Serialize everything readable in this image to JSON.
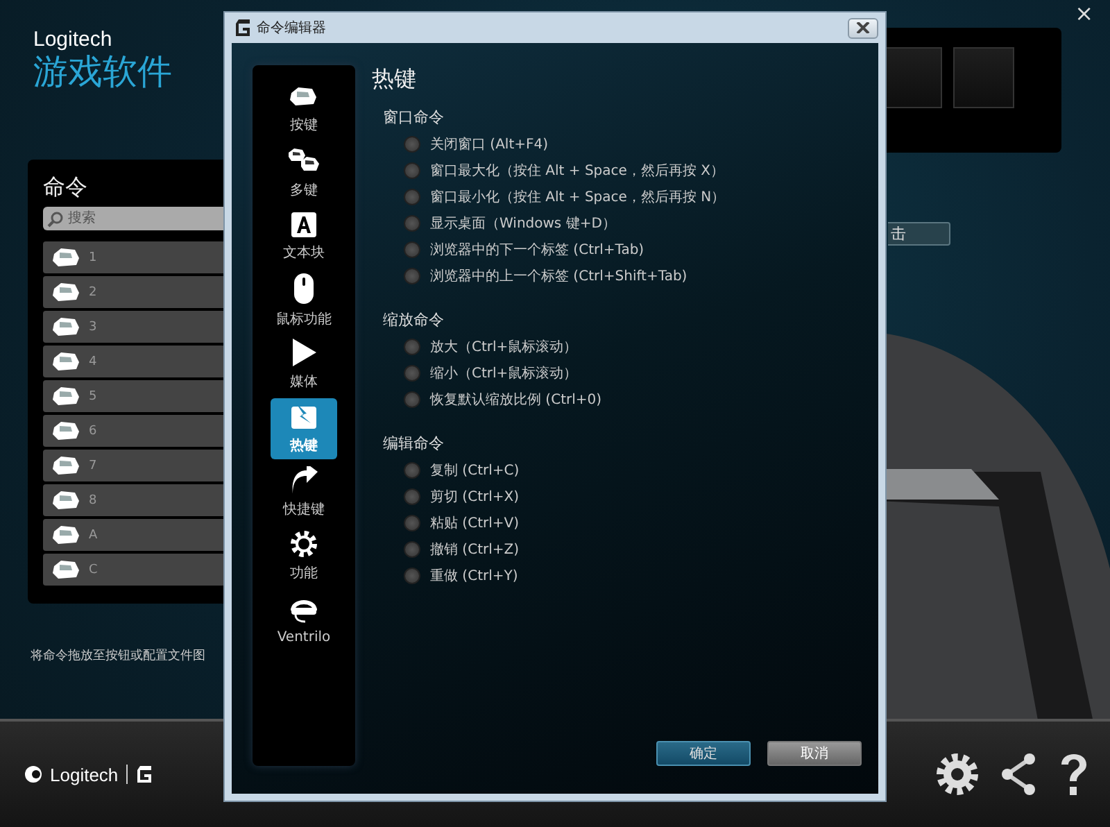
{
  "app": {
    "brand": "Logitech",
    "title": "游戏软件",
    "close": "×",
    "commands": {
      "title": "命令",
      "search": {
        "placeholder": "搜索"
      },
      "items": [
        {
          "label": "1"
        },
        {
          "label": "2"
        },
        {
          "label": "3"
        },
        {
          "label": "4"
        },
        {
          "label": "5"
        },
        {
          "label": "6"
        },
        {
          "label": "7"
        },
        {
          "label": "8"
        },
        {
          "label": "A"
        },
        {
          "label": "C"
        }
      ]
    },
    "hint": "将命令拖放至按钮或配置文件图",
    "partial_button": "击",
    "footer": {
      "logo": "Logitech"
    }
  },
  "dialog": {
    "title": "命令编辑器",
    "sidebar": [
      {
        "kind": "key",
        "label": "按键",
        "selected": false
      },
      {
        "kind": "multikey",
        "label": "多键",
        "selected": false
      },
      {
        "kind": "text",
        "label": "文本块",
        "selected": false
      },
      {
        "kind": "mouse",
        "label": "鼠标功能",
        "selected": false
      },
      {
        "kind": "media",
        "label": "媒体",
        "selected": false
      },
      {
        "kind": "hotkey",
        "label": "热键",
        "selected": true
      },
      {
        "kind": "shortcut",
        "label": "快捷键",
        "selected": false
      },
      {
        "kind": "function",
        "label": "功能",
        "selected": false
      },
      {
        "kind": "headset",
        "label": "Ventrilo",
        "selected": false
      }
    ],
    "heading": "热键",
    "groups": [
      {
        "title": "窗口命令",
        "options": [
          {
            "label": "关闭窗口 (Alt+F4)",
            "selected": false
          },
          {
            "label": "窗口最大化（按住 Alt + Space，然后再按 X）",
            "selected": false
          },
          {
            "label": "窗口最小化（按住 Alt + Space，然后再按 N）",
            "selected": false
          },
          {
            "label": "显示桌面（Windows 键+D）",
            "selected": false
          },
          {
            "label": "浏览器中的下一个标签 (Ctrl+Tab)",
            "selected": false
          },
          {
            "label": "浏览器中的上一个标签 (Ctrl+Shift+Tab)",
            "selected": false
          }
        ]
      },
      {
        "title": "缩放命令",
        "options": [
          {
            "label": "放大（Ctrl+鼠标滚动）",
            "selected": false
          },
          {
            "label": "缩小（Ctrl+鼠标滚动）",
            "selected": false
          },
          {
            "label": "恢复默认缩放比例 (Ctrl+0)",
            "selected": false
          }
        ]
      },
      {
        "title": "编辑命令",
        "options": [
          {
            "label": "复制 (Ctrl+C)",
            "selected": false
          },
          {
            "label": "剪切 (Ctrl+X)",
            "selected": false
          },
          {
            "label": "粘贴 (Ctrl+V)",
            "selected": false
          },
          {
            "label": "撤销 (Ctrl+Z)",
            "selected": false
          },
          {
            "label": "重做 (Ctrl+Y)",
            "selected": false
          }
        ]
      }
    ],
    "buttons": [
      {
        "label": "确定",
        "kind": "primary"
      },
      {
        "label": "取消",
        "kind": "secondary"
      }
    ]
  }
}
